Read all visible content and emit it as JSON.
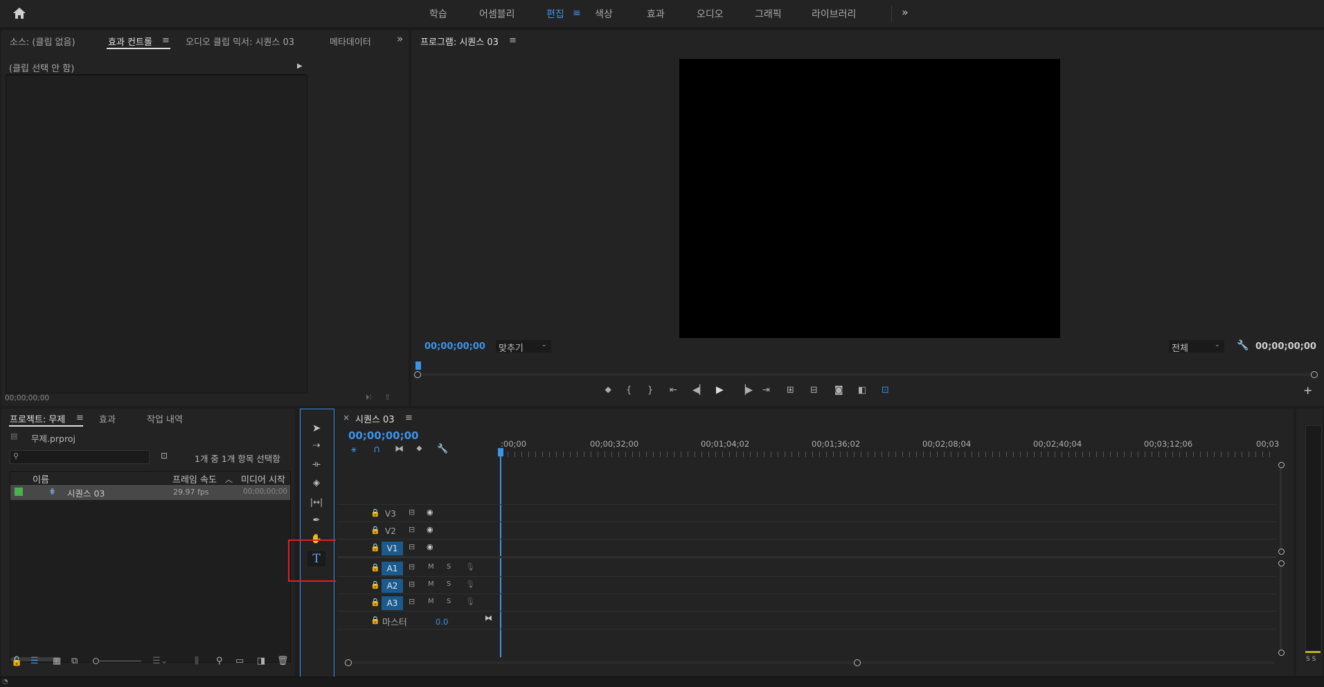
{
  "topbar": {
    "workspaces": [
      "학습",
      "어셈블리",
      "편집",
      "색상",
      "효과",
      "오디오",
      "그래픽",
      "라이브러리"
    ],
    "active": "편집",
    "more": "»"
  },
  "source_panel": {
    "tabs": [
      "소스: (클립 없음)",
      "효과 컨트롤",
      "오디오 클립 믹서: 시퀀스 03",
      "메타데이터"
    ],
    "active_tab": "효과 컨트롤",
    "clip_label": "(클립 선택 안 함)",
    "timecode": "00;00;00;00"
  },
  "program": {
    "title": "프로그램: 시퀀스 03",
    "timecode_left": "00;00;00;00",
    "fit": "맞추기",
    "quality": "전체",
    "timecode_right": "00;00;00;00"
  },
  "project": {
    "tabs": [
      "프로젝트: 무제",
      "효과",
      "작업 내역"
    ],
    "active_tab": "프로젝트: 무제",
    "file": "무제.prproj",
    "selection_info": "1개 중 1개 항목 선택함",
    "search_placeholder": "",
    "columns": [
      "이름",
      "프레임 속도",
      "미디어 시작"
    ],
    "rows": [
      {
        "name": "시퀀스 03",
        "fps": "29.97 fps",
        "start": "00;00;00;00",
        "color": "#4caf50"
      }
    ]
  },
  "timeline": {
    "title": "시퀀스 03",
    "close": "×",
    "timecode": "00;00;00;00",
    "ruler": [
      ":00;00",
      "00;00;32;00",
      "00;01;04;02",
      "00;01;36;02",
      "00;02;08;04",
      "00;02;40;04",
      "00;03;12;06",
      "00;03"
    ],
    "video_tracks": [
      "V3",
      "V2",
      "V1"
    ],
    "audio_tracks": [
      "A1",
      "A2",
      "A3"
    ],
    "master_label": "마스터",
    "master_value": "0.0",
    "mute": "M",
    "solo": "S"
  },
  "meter": {
    "labels": "S S"
  },
  "colors": {
    "accent": "#3d93e8",
    "highlight_box": "#e02020",
    "track_blue": "#1c5a8c"
  }
}
